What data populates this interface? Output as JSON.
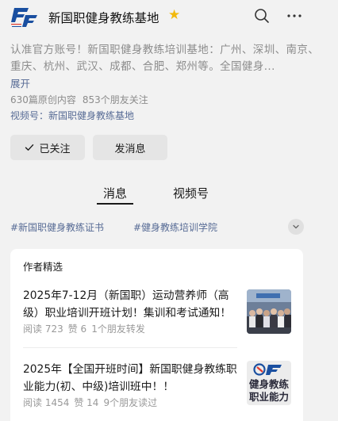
{
  "header": {
    "title": "新国职健身教练基地",
    "logo_caption": "新国职健身教练基地"
  },
  "profile": {
    "description": "认准官方账号！新国职健身教练培训基地：广州、深圳、南京、重庆、杭州、武汉、成都、合肥、郑州等。全国健身...",
    "expand_label": "展开",
    "original_count": "630篇原创内容",
    "friends_following": "853个朋友关注",
    "video_account": "视频号：新国职健身教练基地"
  },
  "actions": {
    "followed_label": "已关注",
    "message_label": "发消息"
  },
  "tabs": [
    {
      "label": "消息",
      "active": true
    },
    {
      "label": "视频号",
      "active": false
    }
  ],
  "hashtags": [
    "#新国职健身教练证书",
    "#健身教练培训学院"
  ],
  "featured": {
    "title": "作者精选",
    "articles": [
      {
        "title": "2025年7-12月（新国职）运动营养师（高级）职业培训开班计划！集训和考试通知！",
        "reads": "阅读 723",
        "likes": "赞 6",
        "shares": "1个朋友转发",
        "thumb_icon": "group-photo-thumbnail"
      },
      {
        "title": "2025年【全国开班时间】新国职健身教练职业能力(初、中级)培训班中！！",
        "reads": "阅读 1454",
        "likes": "赞 14",
        "shares": "9个朋友读过",
        "thumb_line1": "健身教练",
        "thumb_line2": "职业能力"
      }
    ]
  },
  "colors": {
    "link": "#576b95",
    "star": "#f2b90d",
    "brand_blue": "#1a4fa0",
    "brand_red": "#e03a2e"
  }
}
